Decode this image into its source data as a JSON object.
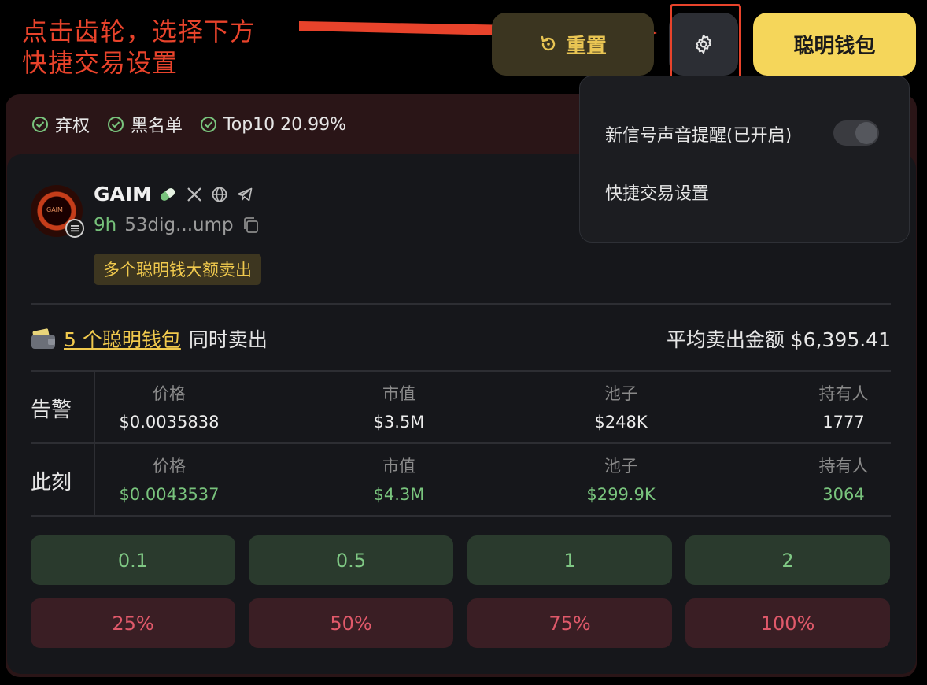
{
  "annotation": {
    "line1": "点击齿轮，选择下方",
    "line2": "快捷交易设置"
  },
  "toolbar": {
    "reset_label": "重置",
    "wallet_label": "聪明钱包"
  },
  "menu": {
    "sound_label": "新信号声音提醒(已开启)",
    "sound_enabled": true,
    "quick_trade_label": "快捷交易设置"
  },
  "checks": [
    {
      "label": "弃权"
    },
    {
      "label": "黑名单"
    },
    {
      "label": "Top10 20.99%"
    }
  ],
  "token": {
    "avatar_text": "GAIM",
    "name": "GAIM",
    "age": "9h",
    "address": "53dig...ump",
    "tag": "多个聪明钱大额卖出"
  },
  "summary": {
    "wallet_count": "5 个聪明钱包",
    "action": "同时卖出",
    "avg_sell": "平均卖出金额 $6,395.41"
  },
  "stats": {
    "headers": [
      "价格",
      "市值",
      "池子",
      "持有人"
    ],
    "alert": {
      "label": "告警",
      "values": [
        "$0.0035838",
        "$3.5M",
        "$248K",
        "1777"
      ]
    },
    "now": {
      "label": "此刻",
      "values": [
        "$0.0043537",
        "$4.3M",
        "$299.9K",
        "3064"
      ]
    }
  },
  "buy_amounts": [
    "0.1",
    "0.5",
    "1",
    "2"
  ],
  "sell_percents": [
    "25%",
    "50%",
    "75%",
    "100%"
  ],
  "colors": {
    "annotation": "#e8432b",
    "accent_yellow": "#f5d65a",
    "buy_green": "#7fc884",
    "sell_red": "#e0596a"
  }
}
